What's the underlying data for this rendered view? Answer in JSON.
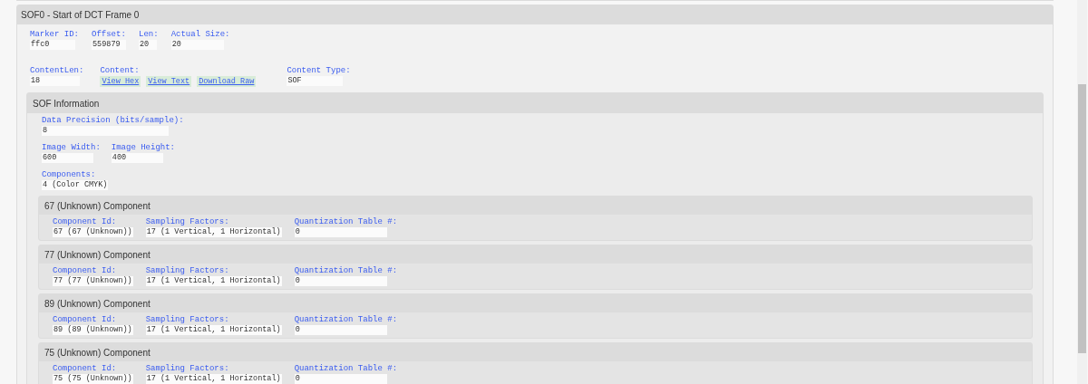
{
  "segment": {
    "title": "SOF0 - Start of DCT Frame 0",
    "row_1": [
      {
        "label": "Marker ID:",
        "value": "ffc0"
      },
      {
        "label": "Offset:",
        "value": "559879"
      },
      {
        "label": "Len:",
        "value": "20"
      },
      {
        "label": "Actual Size:",
        "value": "20"
      }
    ],
    "row_2": [
      {
        "kind": "text",
        "label": "ContentLen:",
        "value": "18"
      },
      {
        "kind": "links",
        "label": "Content:",
        "links": [
          "View Hex",
          "View Text",
          "Download Raw"
        ]
      },
      {
        "kind": "text",
        "label": "Content Type:",
        "value": "SOF"
      }
    ],
    "sof_information": {
      "title": "SOF Information",
      "rows": [
        [
          {
            "label": "Data Precision (bits/sample):",
            "value": "8"
          }
        ],
        [
          {
            "label": "Image Width:",
            "value": "600"
          },
          {
            "label": "Image Height:",
            "value": "400"
          }
        ],
        [
          {
            "label": "Components:",
            "value": "4 (Color CMYK)"
          }
        ]
      ],
      "components": [
        {
          "title": "67 (Unknown) Component",
          "fields": [
            {
              "label": "Component Id:",
              "value": "67 (67 (Unknown))"
            },
            {
              "label": "Sampling Factors:",
              "value": "17 (1 Vertical, 1 Horizontal)"
            },
            {
              "label": "Quantization Table #:",
              "value": "0"
            }
          ]
        },
        {
          "title": "77 (Unknown) Component",
          "fields": [
            {
              "label": "Component Id:",
              "value": "77 (77 (Unknown))"
            },
            {
              "label": "Sampling Factors:",
              "value": "17 (1 Vertical, 1 Horizontal)"
            },
            {
              "label": "Quantization Table #:",
              "value": "0"
            }
          ]
        },
        {
          "title": "89 (Unknown) Component",
          "fields": [
            {
              "label": "Component Id:",
              "value": "89 (89 (Unknown))"
            },
            {
              "label": "Sampling Factors:",
              "value": "17 (1 Vertical, 1 Horizontal)"
            },
            {
              "label": "Quantization Table #:",
              "value": "0"
            }
          ]
        },
        {
          "title": "75 (Unknown) Component",
          "fields": [
            {
              "label": "Component Id:",
              "value": "75 (75 (Unknown))"
            },
            {
              "label": "Sampling Factors:",
              "value": "17 (1 Vertical, 1 Horizontal)"
            },
            {
              "label": "Quantization Table #:",
              "value": "0"
            }
          ]
        }
      ]
    }
  }
}
